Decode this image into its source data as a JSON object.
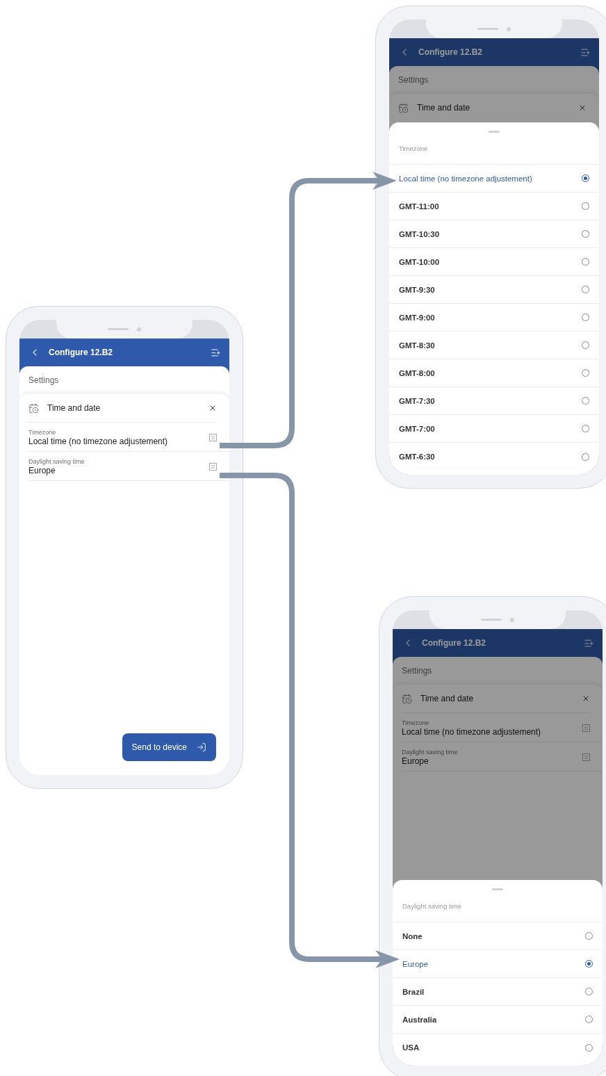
{
  "screens": [
    {
      "header": {
        "title": "Configure 12.B2"
      },
      "section": "Settings",
      "card": {
        "title": "Time and date"
      },
      "fields": [
        {
          "label": "Timezone",
          "value": "Local time (no timezone adjustement)"
        },
        {
          "label": "Daylight saving time",
          "value": "Europe"
        }
      ],
      "button": {
        "label": "Send to device"
      },
      "dimmed": false
    },
    {
      "header": {
        "title": "Configure 12.B2"
      },
      "section": "Settings",
      "card": {
        "title": "Time and date"
      },
      "dimmed": true,
      "sheet": {
        "title": "Timezone",
        "options": [
          {
            "label": "Local time (no timezone adjustement)",
            "selected": true
          },
          {
            "label": "GMT-11:00",
            "selected": false
          },
          {
            "label": "GMT-10:30",
            "selected": false
          },
          {
            "label": "GMT-10:00",
            "selected": false
          },
          {
            "label": "GMT-9:30",
            "selected": false
          },
          {
            "label": "GMT-9:00",
            "selected": false
          },
          {
            "label": "GMT-8:30",
            "selected": false
          },
          {
            "label": "GMT-8:00",
            "selected": false
          },
          {
            "label": "GMT-7:30",
            "selected": false
          },
          {
            "label": "GMT-7:00",
            "selected": false
          },
          {
            "label": "GMT-6:30",
            "selected": false
          }
        ]
      }
    },
    {
      "header": {
        "title": "Configure 12.B2"
      },
      "section": "Settings",
      "card": {
        "title": "Time and date"
      },
      "fields": [
        {
          "label": "Timezone",
          "value": "Local time (no timezone adjustement)"
        },
        {
          "label": "Daylight saving time",
          "value": "Europe"
        }
      ],
      "dimmed": true,
      "sheet": {
        "title": "Daylight saving time",
        "options": [
          {
            "label": "None",
            "selected": false
          },
          {
            "label": "Europe",
            "selected": true
          },
          {
            "label": "Brazil",
            "selected": false
          },
          {
            "label": "Australia",
            "selected": false
          },
          {
            "label": "USA",
            "selected": false
          }
        ]
      }
    }
  ]
}
